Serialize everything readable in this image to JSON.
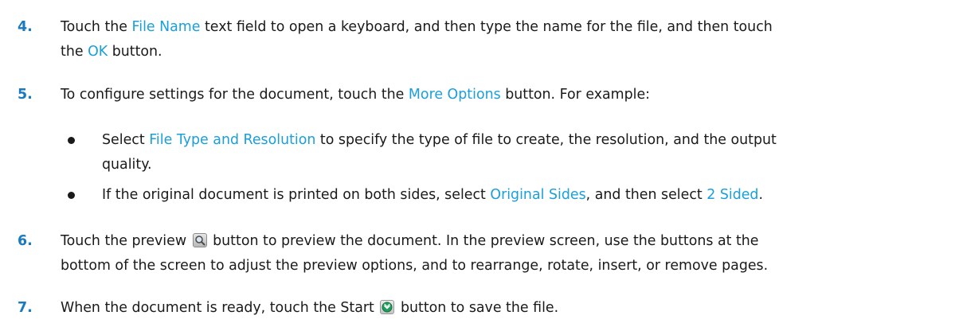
{
  "steps": [
    {
      "num": "4.",
      "line1": {
        "t1": "Touch the ",
        "u1": "File Name",
        "t2": " text field to open a keyboard, and then type the name for the file, and then touch"
      },
      "line2": {
        "t1": "the ",
        "u1": "OK",
        "t2": " button."
      }
    },
    {
      "num": "5.",
      "line1": {
        "t1": "To configure settings for the document, touch the ",
        "u1": "More Options",
        "t2": " button. For example:"
      },
      "bullets": [
        {
          "line1": {
            "t1": "Select ",
            "u1": "File Type and Resolution",
            "t2": " to specify the type of file to create, the resolution, and the output"
          },
          "line2": "quality."
        },
        {
          "line1": {
            "t1": "If the original document is printed on both sides, select ",
            "u1": "Original Sides",
            "t2": ", and then select ",
            "u2": "2 Sided",
            "t3": "."
          }
        }
      ]
    },
    {
      "num": "6.",
      "line1": {
        "t1": "Touch the preview ",
        "icon": "preview-magnifier-icon",
        "t2": " button to preview the document. In the preview screen, use the buttons at the"
      },
      "line2": "bottom of the screen to adjust the preview options, and to rearrange, rotate, insert, or remove pages."
    },
    {
      "num": "7.",
      "line1": {
        "t1": "When the document is ready, touch the Start ",
        "icon": "start-button-icon",
        "t2": " button to save the file."
      }
    }
  ],
  "colors": {
    "step_number": "#1a7abf",
    "ui_text": "#1a9fdb",
    "body_text": "#1a1a1a",
    "start_icon_green": "#1f9e5a"
  }
}
